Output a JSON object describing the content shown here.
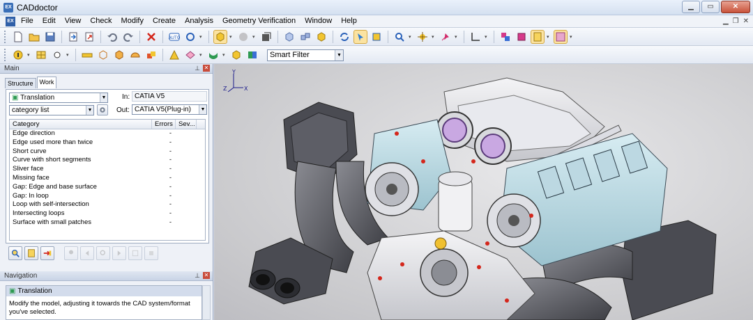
{
  "window": {
    "title": "CADdoctor",
    "app_icon_text": "EX"
  },
  "menu": {
    "items": [
      "File",
      "Edit",
      "View",
      "Check",
      "Modify",
      "Create",
      "Analysis",
      "Geometry Verification",
      "Window",
      "Help"
    ]
  },
  "toolbar": {
    "smart_filter": "Smart Filter"
  },
  "main_panel": {
    "title": "Main",
    "tabs": [
      "Structure",
      "Work"
    ],
    "mode_combo": "Translation",
    "list_combo": "category list",
    "in_label": "In:",
    "in_value": "CATIA V5",
    "out_label": "Out:",
    "out_value": "CATIA V5(Plug-in)",
    "columns": [
      "Category",
      "Errors",
      "Sev..."
    ],
    "rows": [
      {
        "category": "Edge direction",
        "errors": "-"
      },
      {
        "category": "Edge used more than twice",
        "errors": "-"
      },
      {
        "category": "Short curve",
        "errors": "-"
      },
      {
        "category": "Curve with short segments",
        "errors": "-"
      },
      {
        "category": "Sliver face",
        "errors": "-"
      },
      {
        "category": "Missing face",
        "errors": "-"
      },
      {
        "category": "Gap: Edge and base surface",
        "errors": "-"
      },
      {
        "category": "Gap: In loop",
        "errors": "-"
      },
      {
        "category": "Loop with self-intersection",
        "errors": "-"
      },
      {
        "category": "Intersecting loops",
        "errors": "-"
      },
      {
        "category": "Surface with small patches",
        "errors": "-"
      }
    ]
  },
  "navigation": {
    "title": "Navigation",
    "item_title": "Translation",
    "description": "Modify the model, adjusting it towards the CAD system/format you've selected."
  },
  "viewport": {
    "axes": {
      "x": "X",
      "y": "Y",
      "z": "Z"
    }
  }
}
